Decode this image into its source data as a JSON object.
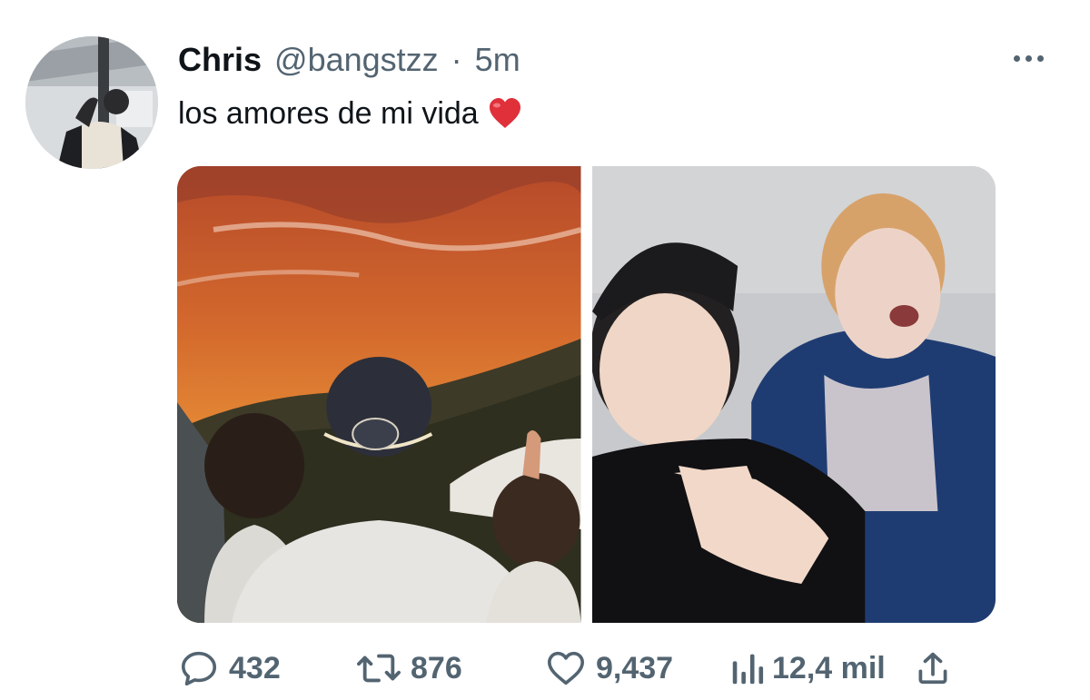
{
  "tweet": {
    "display_name": "Chris",
    "handle": "@bangstzz",
    "separator": "·",
    "time": "5m",
    "text": "los amores de mi vida",
    "emoji": "red-heart-emoji"
  },
  "stats": {
    "replies": "432",
    "retweets": "876",
    "likes": "9,437",
    "views": "12,4 mil"
  },
  "icons": {
    "more": "more-dots-icon",
    "reply": "reply-icon",
    "retweet": "retweet-icon",
    "like": "heart-icon",
    "views": "views-icon",
    "share": "share-icon"
  },
  "colors": {
    "name": "#0f1419",
    "secondary": "#536471",
    "heart": "#e0303a"
  }
}
